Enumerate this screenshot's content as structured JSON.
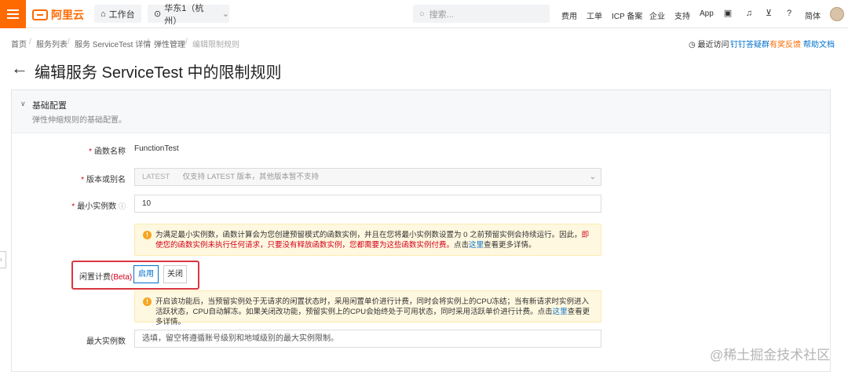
{
  "topbar": {
    "logo": "阿里云",
    "workbench": "工作台",
    "region": "华东1（杭州）",
    "search_placeholder": "搜索...",
    "nav": [
      "费用",
      "工单",
      "ICP 备案",
      "企业",
      "支持",
      "App"
    ],
    "lang": "简体"
  },
  "breadcrumb": [
    "首页",
    "服务列表",
    "服务 ServiceTest 详情",
    "弹性管理",
    "编辑限制规则"
  ],
  "header_links": {
    "recent": "最近访问",
    "dingtalk": "钉钉答疑群",
    "feedback": "有奖反馈",
    "help": "帮助文档"
  },
  "page_title": "编辑服务 ServiceTest 中的限制规则",
  "section": {
    "title": "基础配置",
    "desc": "弹性伸缩规则的基础配置。"
  },
  "form": {
    "func_label": "函数名称",
    "func_value": "FunctionTest",
    "version_label": "版本或别名",
    "version_value": "LATEST",
    "version_hint": "仅支持 LATEST 版本，其他版本暂不支持",
    "min_label": "最小实例数",
    "min_value": "10",
    "warn1_a": "为满足最小实例数，函数计算会为您创建预留模式的函数实例，并且在您将最小实例数设置为 0 之前预留实例会持续运行。因此，",
    "warn1_red": "即使您的函数实例未执行任何请求，只要没有释放函数实例，您都需要为这些函数实例付费。",
    "warn1_b": "点击",
    "warn1_link": "这里",
    "warn1_c": "查看更多详情。",
    "idle_label": "闲置计费",
    "idle_beta": "(Beta)",
    "btn_on": "启用",
    "btn_off": "关闭",
    "warn2_a": "开启该功能后，当预留实例处于无请求的闲置状态时，采用闲置单价进行计费，同时会将实例上的CPU冻结；当有新请求时实例进入活跃状态，CPU自动解冻。如果关闭改功能，预留实例上的CPU会始终处于可用状态，同时采用活跃单价进行计费。点击",
    "warn2_link": "这里",
    "warn2_b": "查看更多详情。",
    "max_label": "最大实例数",
    "max_placeholder": "选填，留空将遵循账号级别和地域级别的最大实例限制。"
  },
  "watermark": "@稀土掘金技术社区"
}
